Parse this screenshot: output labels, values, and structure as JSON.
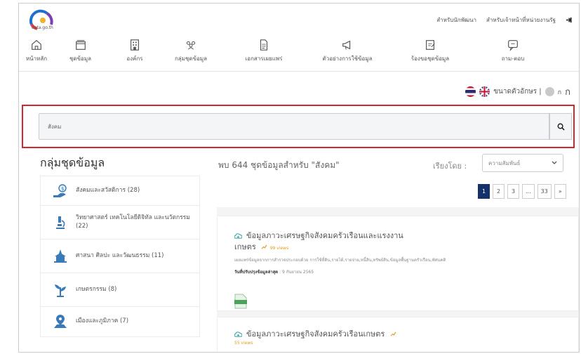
{
  "header": {
    "logo_text": "data.go.th",
    "links": [
      "สำหรับนักพัฒนา",
      "สำหรับเจ้าหน้าที่หน่วยงานรัฐ"
    ]
  },
  "nav": [
    {
      "label": "หน้าหลัก",
      "icon": "home-icon"
    },
    {
      "label": "ชุดข้อมูล",
      "icon": "folder-icon"
    },
    {
      "label": "องค์กร",
      "icon": "building-icon"
    },
    {
      "label": "กลุ่มชุดข้อมูล",
      "icon": "group-icon"
    },
    {
      "label": "เอกสารเผยแพร่",
      "icon": "document-icon"
    },
    {
      "label": "ตัวอย่างการใช้ข้อมูล",
      "icon": "megaphone-icon"
    },
    {
      "label": "ร้องขอชุดข้อมูล",
      "icon": "request-icon"
    },
    {
      "label": "ถาม-ตอบ",
      "icon": "chat-icon"
    }
  ],
  "font_size": {
    "label": "ขนาดตัวอักษร |",
    "small": "ก",
    "large": "ก"
  },
  "search": {
    "value": "สังคม"
  },
  "sidebar": {
    "title": "กลุ่มชุดข้อมูล",
    "categories": [
      {
        "label": "สังคมและสวัสดิการ (28)",
        "icon": "welfare-hand-icon"
      },
      {
        "label": "วิทยาศาสตร์ เทคโนโลยีดิจิทัล และนวัตกรรม (22)",
        "icon": "microscope-icon"
      },
      {
        "label": "ศาสนา ศิลปะ และวัฒนธรรม (11)",
        "icon": "temple-icon"
      },
      {
        "label": "เกษตรกรรม (8)",
        "icon": "plant-icon"
      },
      {
        "label": "เมืองและภูมิภาค (7)",
        "icon": "map-pin-icon"
      }
    ]
  },
  "results": {
    "summary": "พบ 644 ชุดข้อมูลสำหรับ \"สังคม\"",
    "sort_label": "เรียงโดย :",
    "sort_value": "ความสัมพันธ์",
    "pages": [
      "1",
      "2",
      "3",
      "...",
      "33",
      "»"
    ],
    "items": [
      {
        "title_line1": "ข้อมูลภาวะเศรษฐกิจสังคมครัวเรือนและแรงงาน",
        "title_line2": "เกษตร",
        "views": "99 views",
        "description": "เผยแพร่ข้อมูลจากการสำรวจประกอบด้วย การใช้ที่ดิน,รายได้,รายจ่าย,หนี้สิน,ทรัพย์สิน,ข้อมูลพื้นฐานครัวเรือน,ทัศนคติ",
        "updated_label": "วันที่ปรับปรุงข้อมูลล่าสุด",
        "updated_value": ": 9 กันยายน 2565",
        "file_type": "XLSX"
      },
      {
        "title_line1": "ข้อมูลภาวะเศรษฐกิจสังคมครัวเรือนเกษตร",
        "views": "55 views"
      }
    ]
  }
}
